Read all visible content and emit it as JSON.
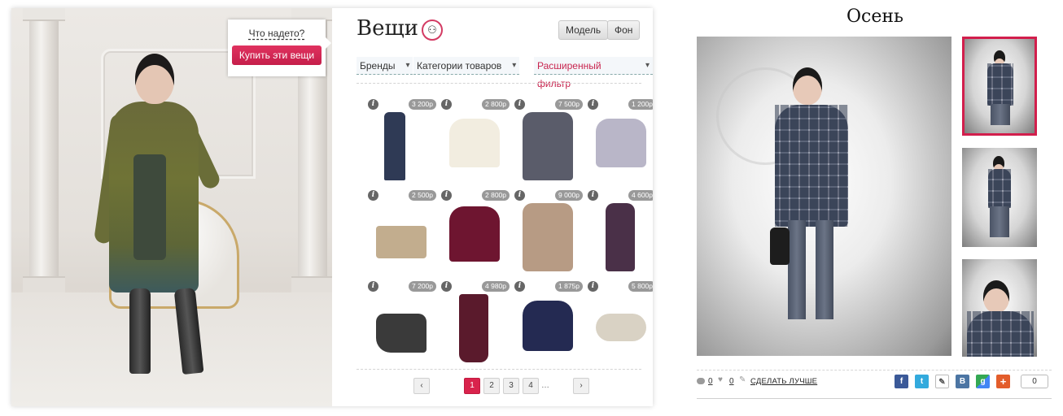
{
  "stage": {
    "what_worn_label": "Что надето?",
    "buy_button_label": "Купить эти вещи"
  },
  "catalog": {
    "title": "Вещи",
    "title_icon": "hanger-icon",
    "tabs": [
      {
        "label": "Модель"
      },
      {
        "label": "Фон"
      }
    ],
    "filters": {
      "brands": "Бренды",
      "categories": "Категории товаров",
      "advanced": "Расширенный фильтр"
    },
    "items": [
      {
        "name": "jeans",
        "price": "3 200р",
        "color": "#2f3a55"
      },
      {
        "name": "blouse",
        "price": "2 800р",
        "color": "#f2ede0"
      },
      {
        "name": "wrap-dress",
        "price": "7 500р",
        "color": "#5a5c6a"
      },
      {
        "name": "jacket",
        "price": "1 200р",
        "color": "#b9b6c8"
      },
      {
        "name": "clutch",
        "price": "2 500р",
        "color": "#c2ad8e"
      },
      {
        "name": "burgundy-top",
        "price": "2 800р",
        "color": "#6e1530"
      },
      {
        "name": "knit-dress",
        "price": "9 000р",
        "color": "#b79b84"
      },
      {
        "name": "maxi-dress",
        "price": "4 600р",
        "color": "#4a3048"
      },
      {
        "name": "boots",
        "price": "7 200р",
        "color": "#3a3a3a"
      },
      {
        "name": "maxi-skirt",
        "price": "4 980р",
        "color": "#5a1a2c"
      },
      {
        "name": "navy-blouse",
        "price": "1 875р",
        "color": "#242a52"
      },
      {
        "name": "bracelet",
        "price": "5 800р",
        "color": "#d9d2c4"
      }
    ],
    "pagination": {
      "prev": "‹",
      "pages": [
        "1",
        "2",
        "3",
        "4"
      ],
      "active_page": "1",
      "ellipsis": "…",
      "next": "›"
    }
  },
  "gallery": {
    "title": "Осень"
  },
  "social": {
    "comments_count": "0",
    "likes_count": "0",
    "improve_link": "СДЕЛАТЬ ЛУЧШЕ",
    "share_buttons": [
      {
        "label": "f",
        "icon": "facebook-icon"
      },
      {
        "label": "t",
        "icon": "twitter-icon"
      },
      {
        "label": "✎",
        "icon": "clip-icon"
      },
      {
        "label": "В",
        "icon": "vkontakte-icon"
      },
      {
        "label": "g",
        "icon": "google-icon"
      },
      {
        "label": "+",
        "icon": "add-icon"
      }
    ],
    "share_count": "0"
  },
  "colors": {
    "accent": "#d21e4c",
    "buy_button": "#d6285a"
  }
}
